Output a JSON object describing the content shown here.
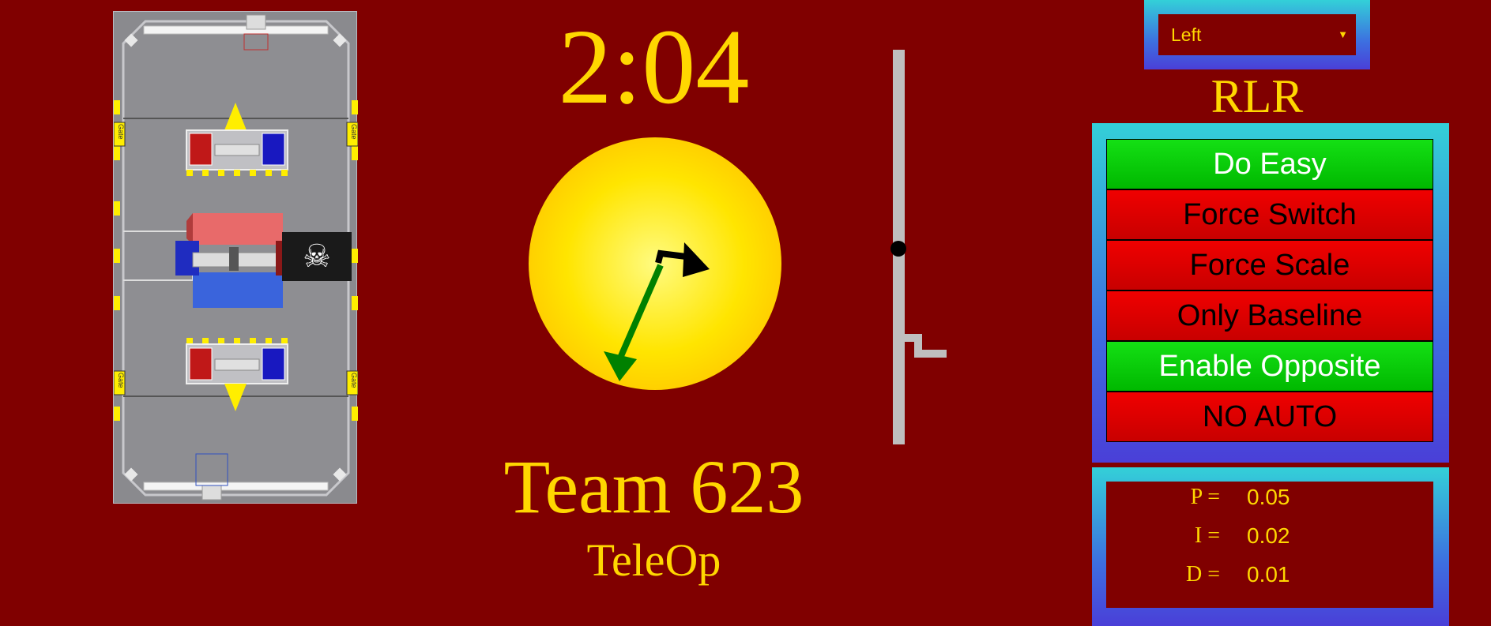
{
  "timer": "2:04",
  "team": "Team 623",
  "mode": "TeleOp",
  "field_map": {
    "gate_label": "Gate",
    "robot_icon": "skull-crossbones-icon",
    "robot_glyph": "☠"
  },
  "starting_side": {
    "selected": "Left"
  },
  "plate_assignment": "RLR",
  "auto_options": [
    {
      "label": "Do Easy",
      "state": "on"
    },
    {
      "label": "Force Switch",
      "state": "off"
    },
    {
      "label": "Force Scale",
      "state": "off"
    },
    {
      "label": "Only Baseline",
      "state": "off"
    },
    {
      "label": "Enable Opposite",
      "state": "on"
    },
    {
      "label": "NO AUTO",
      "state": "off"
    }
  ],
  "pid": {
    "p_label": "P =",
    "p_value": "0.05",
    "i_label": "I =",
    "i_value": "0.02",
    "d_label": "D =",
    "d_value": "0.01"
  },
  "colors": {
    "background": "#800000",
    "text": "#ffd700",
    "option_on": "#00cc00",
    "option_off": "#e00000",
    "gyro_robot_arrow": "#000000",
    "gyro_field_arrow": "#008000"
  }
}
